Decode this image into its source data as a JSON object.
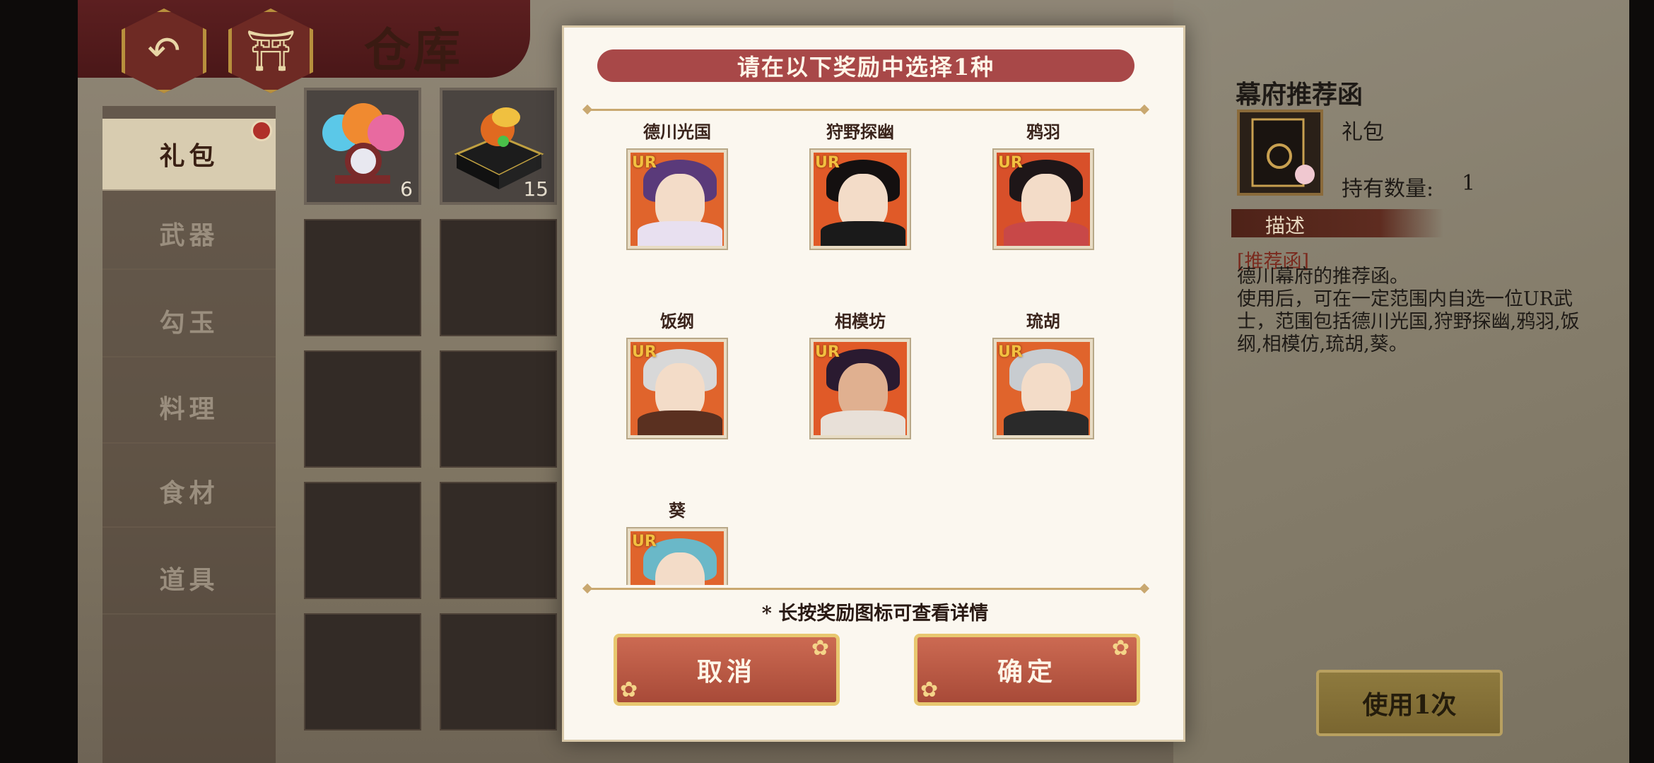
{
  "header": {
    "title": "仓库",
    "back_icon": "↶",
    "home_icon": "⛩"
  },
  "categories": [
    {
      "label": "礼包",
      "active": true
    },
    {
      "label": "武器"
    },
    {
      "label": "勾玉"
    },
    {
      "label": "料理"
    },
    {
      "label": "食材"
    },
    {
      "label": "道具"
    }
  ],
  "inventory": [
    {
      "name": "gift-flames",
      "count": "6"
    },
    {
      "name": "gift-box",
      "count": "15"
    }
  ],
  "modal": {
    "title": "请在以下奖励中选择1种",
    "rewards": [
      {
        "name": "德川光国",
        "rarity": "UR"
      },
      {
        "name": "狩野探幽",
        "rarity": "UR"
      },
      {
        "name": "鸦羽",
        "rarity": "UR"
      },
      {
        "name": "饭纲",
        "rarity": "UR"
      },
      {
        "name": "相模坊",
        "rarity": "UR"
      },
      {
        "name": "琉胡",
        "rarity": "UR"
      },
      {
        "name": "葵",
        "rarity": "UR"
      }
    ],
    "hint": "* 长按奖励图标可查看详情",
    "cancel_label": "取消",
    "confirm_label": "确定"
  },
  "info": {
    "title": "幕府推荐函",
    "type": "礼包",
    "qty_label": "持有数量:",
    "qty": "1",
    "desc_header": "描述",
    "desc_tag": "[推荐函]",
    "desc_body": "德川幕府的推荐函。\n使用后，可在一定范围内自选一位UR武士，范围包括德川光国,狩野探幽,鸦羽,饭纲,相模仿,琉胡,葵。",
    "use_button": "使用1次"
  },
  "colors": {
    "accent": "#a84848",
    "button": "#cc6a52",
    "gold": "#e8c870"
  }
}
